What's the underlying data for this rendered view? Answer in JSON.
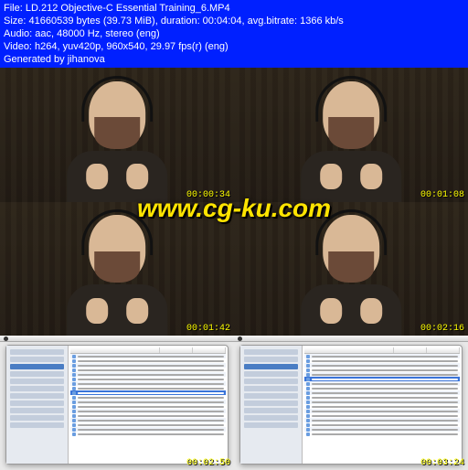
{
  "info": {
    "file": "File: LD.212 Objective-C Essential Training_6.MP4",
    "size": "Size: 41660539 bytes (39.73 MiB), duration: 00:04:04, avg.bitrate: 1366 kb/s",
    "audio": "Audio: aac, 48000 Hz, stereo (eng)",
    "video": "Video: h264, yuv420p, 960x540, 29.97 fps(r) (eng)",
    "gen": "Generated by jihanova"
  },
  "watermark": "www.cg-ku.com",
  "thumbs": [
    {
      "ts": "00:00:34",
      "kind": "studio"
    },
    {
      "ts": "00:01:08",
      "kind": "studio"
    },
    {
      "ts": "00:01:42",
      "kind": "studio"
    },
    {
      "ts": "00:02:16",
      "kind": "studio"
    },
    {
      "ts": "00:02:50",
      "kind": "finder"
    },
    {
      "ts": "00:03:24",
      "kind": "finder"
    }
  ]
}
